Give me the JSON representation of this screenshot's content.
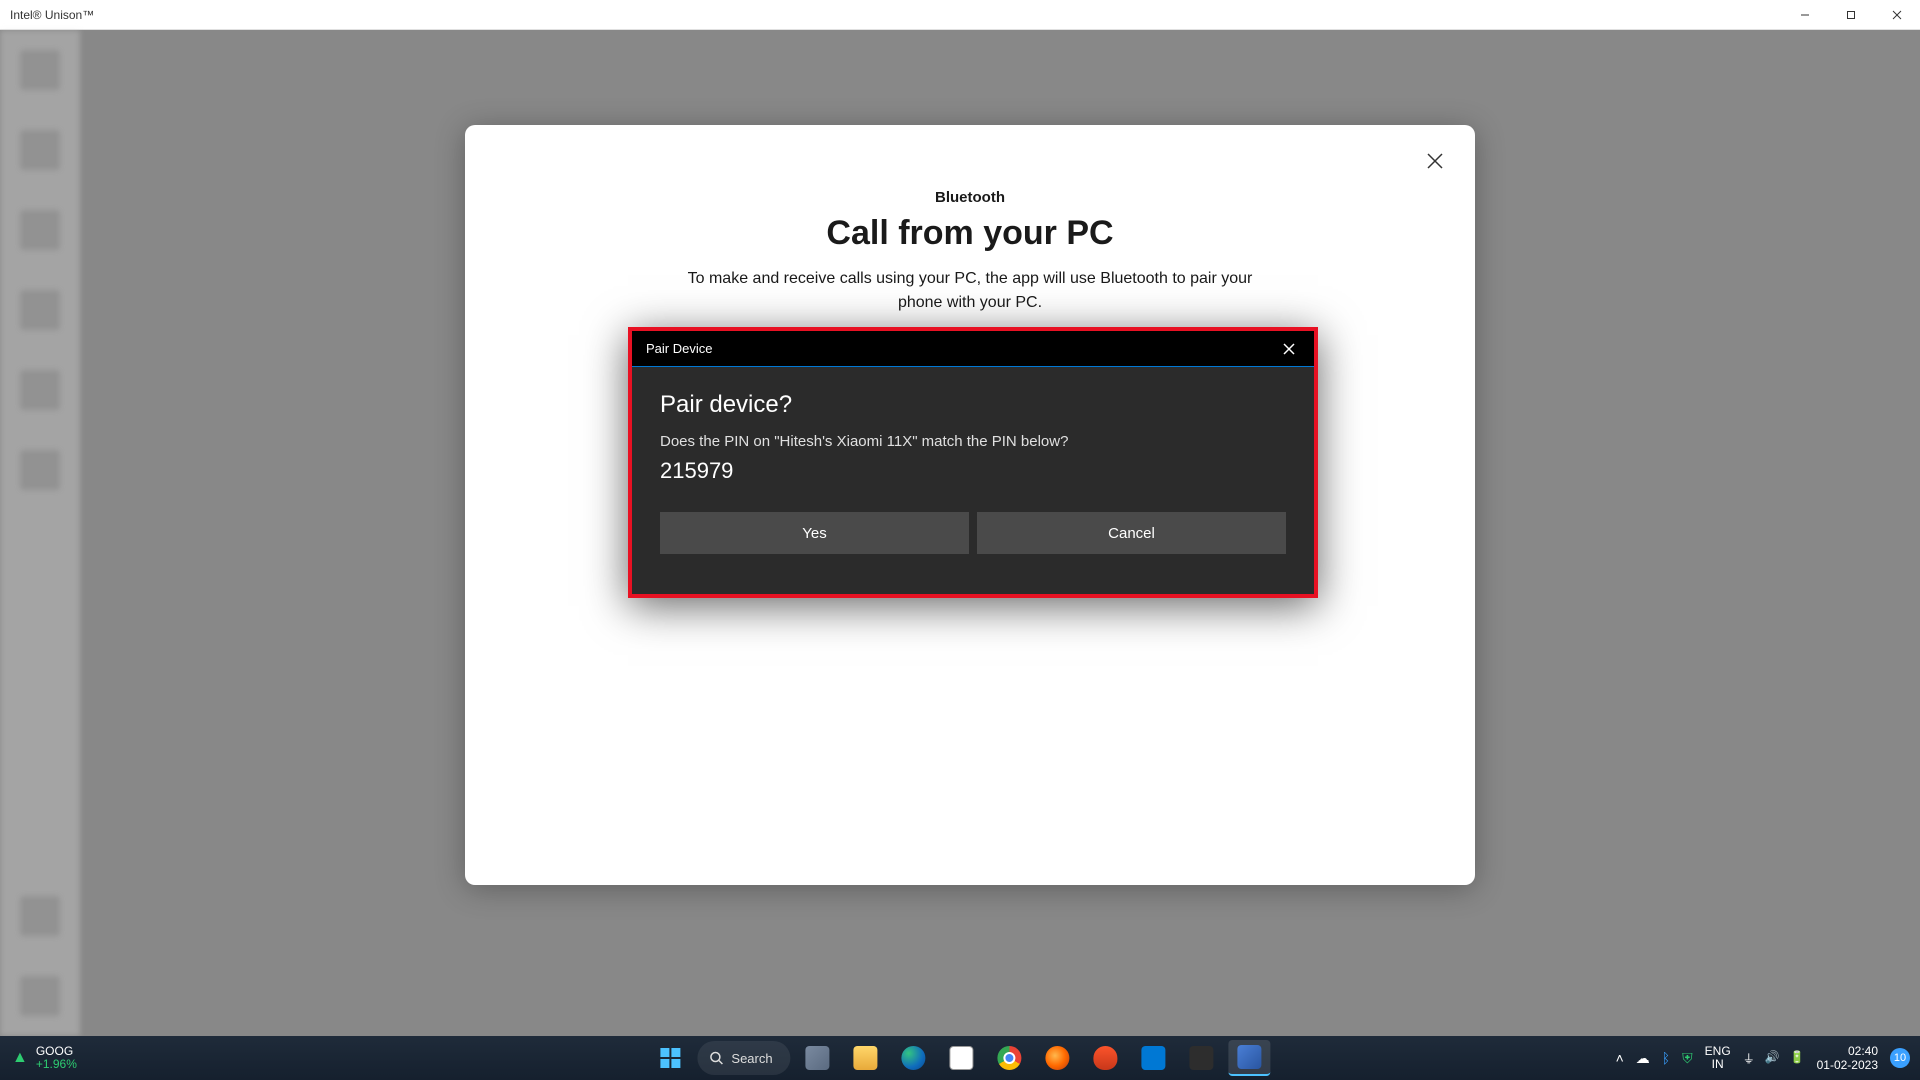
{
  "window": {
    "title": "Intel® Unison™"
  },
  "modal": {
    "subtitle": "Bluetooth",
    "title": "Call from your PC",
    "description": "To make and receive calls using your PC, the app will use Bluetooth to pair your phone with your PC."
  },
  "pair_dialog": {
    "titlebar": "Pair Device",
    "heading": "Pair device?",
    "question": "Does the PIN on \"Hitesh's Xiaomi 11X\" match the PIN below?",
    "pin": "215979",
    "yes": "Yes",
    "cancel": "Cancel"
  },
  "taskbar": {
    "stock": {
      "ticker": "GOOG",
      "change": "+1.96%"
    },
    "search_label": "Search",
    "lang": {
      "top": "ENG",
      "bottom": "IN"
    },
    "clock": {
      "time": "02:40",
      "date": "01-02-2023"
    },
    "notif_count": "10"
  }
}
